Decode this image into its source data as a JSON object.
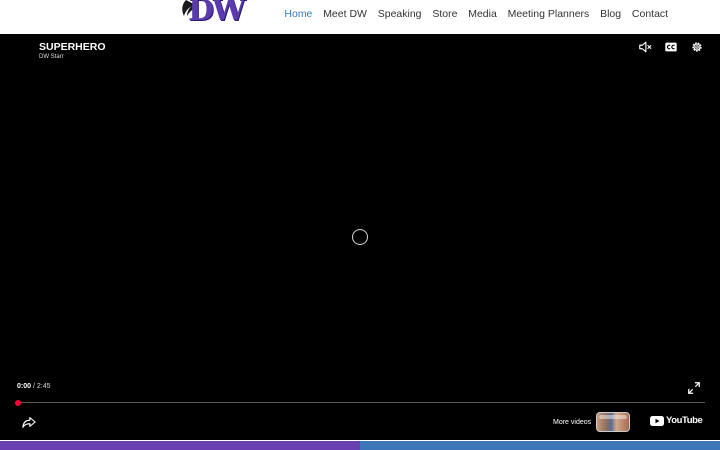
{
  "header": {
    "logo_text": "DW",
    "nav": [
      {
        "label": "Home",
        "active": true
      },
      {
        "label": "Meet DW",
        "active": false
      },
      {
        "label": "Speaking",
        "active": false
      },
      {
        "label": "Store",
        "active": false
      },
      {
        "label": "Media",
        "active": false
      },
      {
        "label": "Meeting Planners",
        "active": false
      },
      {
        "label": "Blog",
        "active": false
      },
      {
        "label": "Contact",
        "active": false
      }
    ],
    "colors": {
      "active_link": "#3a78c6",
      "link": "#333333"
    }
  },
  "player": {
    "title": "SUPERHERO",
    "channel": "DW Starr",
    "time_current": "0:00",
    "time_separator": "/",
    "time_total": "2:45",
    "progress": 0,
    "more_videos_label": "More videos",
    "youtube_label": "YouTube",
    "icons": [
      "mute-icon",
      "captions-icon",
      "settings-icon",
      "fullscreen-icon",
      "share-icon",
      "loading-spinner",
      "youtube-logo-icon"
    ],
    "colors": {
      "progress": "#ff0033",
      "background": "#000000"
    }
  },
  "footer": {
    "colors": {
      "left": "#6a3fb0",
      "right": "#3e74b8"
    }
  }
}
